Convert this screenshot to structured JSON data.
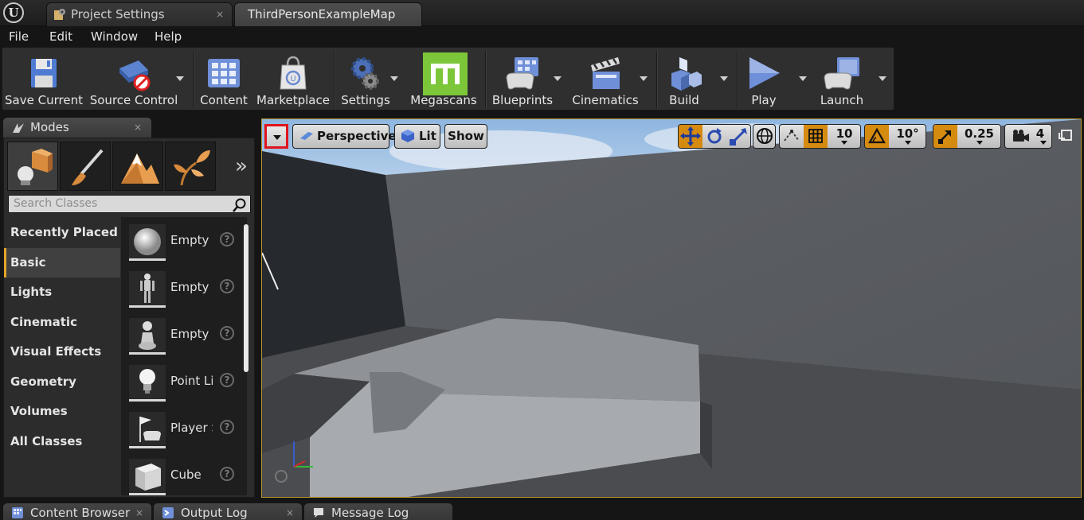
{
  "tabs": [
    {
      "label": "Project Settings",
      "close": "×"
    },
    {
      "label": "ThirdPersonExampleMap"
    }
  ],
  "menu": [
    "File",
    "Edit",
    "Window",
    "Help"
  ],
  "toolbar": {
    "save_current": "Save Current",
    "source_control": "Source Control",
    "content": "Content",
    "marketplace": "Marketplace",
    "settings": "Settings",
    "megascans": "Megascans",
    "blueprints": "Blueprints",
    "cinematics": "Cinematics",
    "build": "Build",
    "play": "Play",
    "launch": "Launch"
  },
  "modes": {
    "tab_label": "Modes",
    "tab_close": "×",
    "more": "»",
    "search_placeholder": "Search Classes",
    "categories": [
      "Recently Placed",
      "Basic",
      "Lights",
      "Cinematic",
      "Visual Effects",
      "Geometry",
      "Volumes",
      "All Classes"
    ],
    "active_category": "Basic",
    "items": [
      {
        "label": "Empty Actor",
        "help": "?"
      },
      {
        "label": "Empty Character",
        "help": "?"
      },
      {
        "label": "Empty Pawn",
        "help": "?"
      },
      {
        "label": "Point Light",
        "help": "?"
      },
      {
        "label": "Player Start",
        "help": "?"
      },
      {
        "label": "Cube",
        "help": "?"
      }
    ]
  },
  "viewport": {
    "perspective": "Perspective",
    "lit": "Lit",
    "show": "Show",
    "grid_snap": "10",
    "rotation_snap": "10°",
    "scale_snap": "0.25",
    "camera_speed": "4",
    "accent_color": "#d58a10",
    "highlight_color": "#e0141c"
  },
  "bottom_tabs": [
    {
      "label": "Content Browser",
      "close": "×"
    },
    {
      "label": "Output Log",
      "close": "×"
    },
    {
      "label": "Message Log"
    }
  ]
}
